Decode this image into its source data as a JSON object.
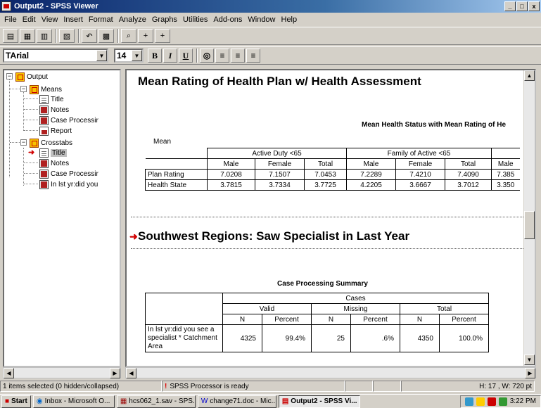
{
  "window": {
    "title": "Output2 - SPSS Viewer",
    "controls": [
      "_",
      "□",
      "x"
    ]
  },
  "menu": [
    "File",
    "Edit",
    "View",
    "Insert",
    "Format",
    "Analyze",
    "Graphs",
    "Utilities",
    "Add-ons",
    "Window",
    "Help"
  ],
  "format_toolbar": {
    "font": "TArial",
    "size": "14",
    "bold": "B",
    "italic": "I",
    "underline": "U"
  },
  "outline": {
    "items": [
      {
        "label": "Output"
      },
      {
        "label": "Means"
      },
      {
        "label": "Title"
      },
      {
        "label": "Notes"
      },
      {
        "label": "Case Processir"
      },
      {
        "label": "Report"
      },
      {
        "label": "Crosstabs"
      },
      {
        "label": "Title"
      },
      {
        "label": "Notes"
      },
      {
        "label": "Case Processir"
      },
      {
        "label": "In lst yr:did you"
      }
    ]
  },
  "content": {
    "title1": "Mean Rating of Health Plan w/ Health Assessment",
    "subtitle1": "Mean Health Status with Mean Rating of He",
    "mean_label": "Mean",
    "table1": {
      "groups": [
        "Active Duty <65",
        "Family of Active <65"
      ],
      "cols": [
        "Male",
        "Female",
        "Total",
        "Male",
        "Female",
        "Total",
        "Male"
      ],
      "rows": [
        {
          "label": "Plan Rating",
          "values": [
            "7.0208",
            "7.1507",
            "7.0453",
            "7.2289",
            "7.4210",
            "7.4090",
            "7.385"
          ]
        },
        {
          "label": "Health State",
          "values": [
            "3.7815",
            "3.7334",
            "3.7725",
            "4.2205",
            "3.6667",
            "3.7012",
            "3.350"
          ]
        }
      ]
    },
    "title2": "Southwest Regions: Saw Specialist in Last Year",
    "cps_title": "Case Processing Summary",
    "table2": {
      "cases": "Cases",
      "groups": [
        "Valid",
        "Missing",
        "Total"
      ],
      "cols": [
        "N",
        "Percent",
        "N",
        "Percent",
        "N",
        "Percent"
      ],
      "row_label": "In lst yr:did you see a specialist * Catchment Area",
      "values": [
        "4325",
        "99.4%",
        "25",
        ".6%",
        "4350",
        "100.0%"
      ]
    }
  },
  "status": {
    "selection": "1 items selected (0 hidden/collapsed)",
    "processor": "SPSS Processor  is ready",
    "dims": "H: 17 , W: 720  pt"
  },
  "taskbar": {
    "start": "Start",
    "tasks": [
      "Inbox - Microsoft O...",
      "hcs062_1.sav - SPS...",
      "change71.doc - Mic...",
      "Output2 - SPSS Vi..."
    ],
    "clock": "3:22 PM"
  }
}
